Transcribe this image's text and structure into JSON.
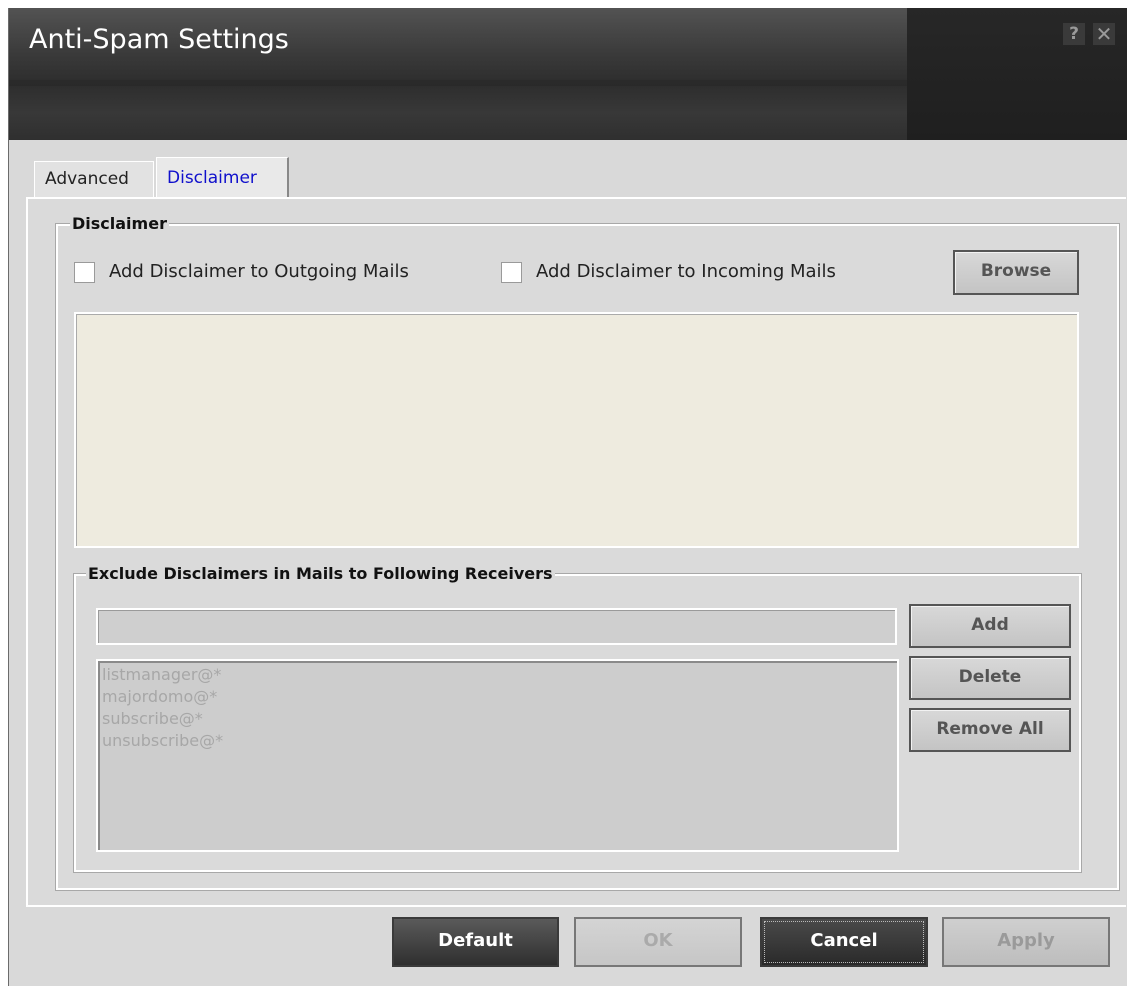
{
  "window": {
    "title": "Anti-Spam Settings",
    "help_glyph": "?",
    "close_glyph": "✕"
  },
  "tabs": [
    {
      "label": "Advanced",
      "active": false
    },
    {
      "label": "Disclaimer",
      "active": true
    }
  ],
  "disclaimer": {
    "group_title": "Disclaimer",
    "outgoing_label": "Add Disclaimer to Outgoing Mails",
    "outgoing_checked": false,
    "incoming_label": "Add Disclaimer to Incoming Mails",
    "incoming_checked": false,
    "browse_label": "Browse",
    "text_value": ""
  },
  "exclude": {
    "group_title": "Exclude Disclaimers in Mails to Following Receivers",
    "input_value": "",
    "items": [
      "listmanager@*",
      "majordomo@*",
      "subscribe@*",
      "unsubscribe@*"
    ],
    "add_label": "Add",
    "delete_label": "Delete",
    "remove_all_label": "Remove All"
  },
  "footer": {
    "default_label": "Default",
    "ok_label": "OK",
    "cancel_label": "Cancel",
    "apply_label": "Apply"
  }
}
